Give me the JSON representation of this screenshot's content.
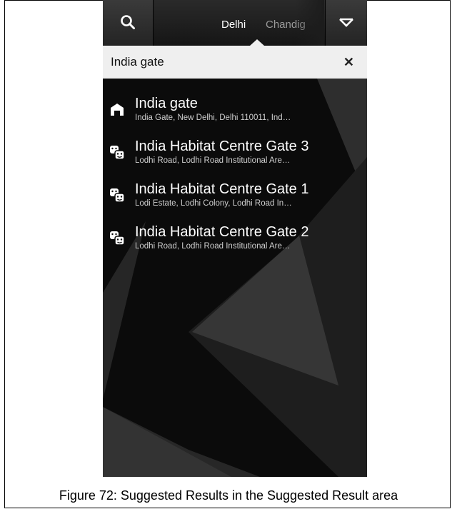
{
  "header": {
    "tabs": [
      {
        "label": "Delhi",
        "active": true
      },
      {
        "label": "Chandig",
        "active": false
      }
    ],
    "icons": {
      "search": "search-icon",
      "menu": "chevron-down-icon"
    }
  },
  "search": {
    "value": "India gate",
    "clear_icon": "close-icon"
  },
  "results": [
    {
      "title": "India gate",
      "subtitle": "India Gate, New Delhi, Delhi 110011, Ind…",
      "icon": "monument-icon"
    },
    {
      "title": "India Habitat Centre Gate 3",
      "subtitle": "Lodhi Road, Lodhi Road Institutional Are…",
      "icon": "theater-masks-icon"
    },
    {
      "title": "India Habitat Centre Gate 1",
      "subtitle": "Lodi Estate, Lodhi Colony, Lodhi Road In…",
      "icon": "theater-masks-icon"
    },
    {
      "title": "India Habitat Centre Gate 2",
      "subtitle": "Lodhi Road, Lodhi Road Institutional Are…",
      "icon": "theater-masks-icon"
    }
  ],
  "caption": "Figure 72: Suggested Results in the Suggested Result area",
  "colors": {
    "bar": "#1c1c1c",
    "search_field": "#efefef",
    "text": "#ffffff",
    "subtext": "#cfcfcf"
  }
}
